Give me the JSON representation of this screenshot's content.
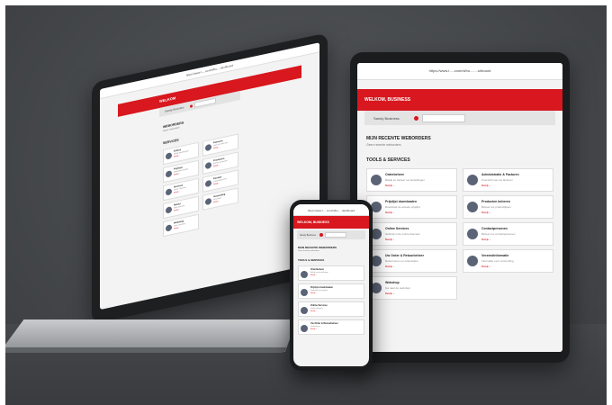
{
  "tablet": {
    "url": "https://www.l.....com/nl/bu........shboard",
    "header_title": "WELKOM, BUSINESS",
    "login_label": "Sandy Business",
    "section_recent": "MIJN RECENTE WEBORDERS",
    "section_recent_sub": "Geen recente weborders",
    "section_tools": "TOOLS & SERVICES",
    "cards": [
      {
        "title": "Orderbeheer",
        "desc": "Bekijk en beheer uw bestellingen",
        "link": "Bekijk ›"
      },
      {
        "title": "Administratie & Facturen",
        "desc": "Overzicht van uw facturen",
        "link": "Bekijk ›"
      },
      {
        "title": "Prijslijst downloaden",
        "desc": "Download de actuele prijslijst",
        "link": "Bekijk ›"
      },
      {
        "title": "Producten beheren",
        "desc": "Beheer uw productlijsten",
        "link": "Bekijk ›"
      },
      {
        "title": "Online Services",
        "desc": "Gebruik onze online diensten",
        "link": "Bekijk ›"
      },
      {
        "title": "Contactpersonen",
        "desc": "Beheer uw contactpersonen",
        "link": "Bekijk ›"
      },
      {
        "title": "Uw Order & Retourbeheer",
        "desc": "Retourneren en orderstatus",
        "link": "Bekijk ›"
      },
      {
        "title": "Verzendinformatie",
        "desc": "Informatie over verzending",
        "link": "Bekijk ›"
      },
      {
        "title": "Webshop",
        "desc": "Ga naar de webshop",
        "link": "Bekijk ›"
      }
    ]
  },
  "laptop": {
    "url": "https://www.l.....com/nl/bu.....dashboard",
    "header_title": "WELKOM",
    "login_label": "Sandy Business",
    "section_recent": "WEBORDERS",
    "section_recent_sub": "Geen weborders",
    "section_tools": "SERVICES",
    "cards": [
      {
        "title": "Orders",
        "desc": "Bekijk bestellingen",
        "link": "Bekijk ›"
      },
      {
        "title": "Facturen",
        "desc": "Overzicht facturen",
        "link": "Bekijk ›"
      },
      {
        "title": "Prijslijst",
        "desc": "Download prijslijst",
        "link": "Bekijk ›"
      },
      {
        "title": "Producten",
        "desc": "Beheer producten",
        "link": "Bekijk ›"
      },
      {
        "title": "Services",
        "desc": "Online diensten",
        "link": "Bekijk ›"
      },
      {
        "title": "Contact",
        "desc": "Contactpersonen",
        "link": "Bekijk ›"
      },
      {
        "title": "Retour",
        "desc": "Retourbeheer",
        "link": "Bekijk ›"
      },
      {
        "title": "Verzending",
        "desc": "Informatie",
        "link": "Bekijk ›"
      },
      {
        "title": "Webshop",
        "desc": "Naar webshop",
        "link": "Bekijk ›"
      }
    ]
  },
  "phone": {
    "url": "https://www.l.....com/nl/bu.....dashboard",
    "header_title": "WELKOM, BUSINESS",
    "login_label": "Sandy Business",
    "section_recent": "MIJN RECENTE WEBORDERS",
    "section_recent_sub": "Geen recente weborders",
    "section_tools": "TOOLS & SERVICES",
    "cards": [
      {
        "title": "Orderbeheer",
        "desc": "Bekijk uw bestellingen",
        "link": "Bekijk ›"
      },
      {
        "title": "Prijslijst downloaden",
        "desc": "Download de prijslijst",
        "link": "Bekijk ›"
      },
      {
        "title": "Online Services",
        "desc": "Online diensten",
        "link": "Bekijk ›"
      },
      {
        "title": "Uw Order & Retourbeheer",
        "desc": "Orderstatus",
        "link": "Bekijk ›"
      }
    ]
  },
  "colors": {
    "brand_red": "#d8171e",
    "icon_gray": "#5b6477",
    "background": "#4a4d50"
  }
}
